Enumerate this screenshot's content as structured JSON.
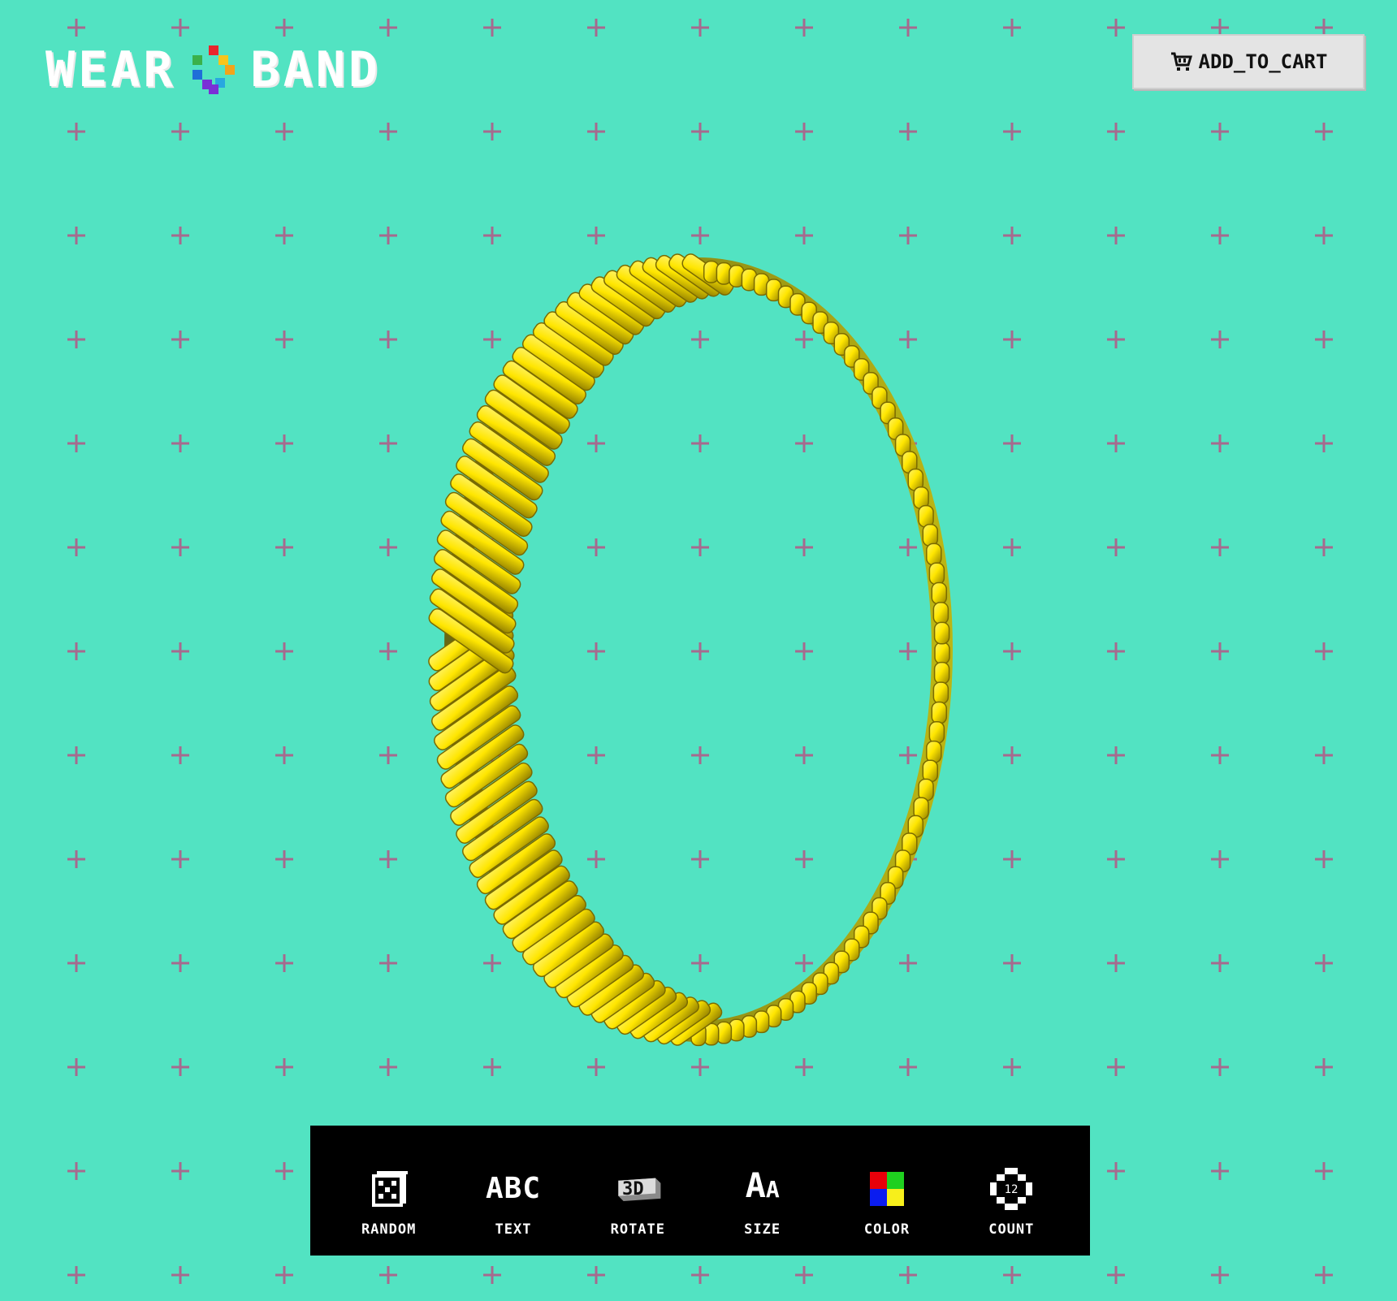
{
  "brand": {
    "word_left": "WEAR",
    "word_right": "BAND",
    "mark_colors": [
      "#e8262c",
      "#f7c51b",
      "#f2a41a",
      "#3ab14a",
      "#1f6fd8",
      "#7a2fd6",
      "#28a8e0"
    ]
  },
  "header": {
    "add_to_cart_label": "ADD_TO_CART",
    "cart_icon": "shopping-cart-icon"
  },
  "viewport": {
    "band_color": "#ffe600",
    "background_color": "#52e3c2",
    "grid_mark_color": "#a66a8e"
  },
  "toolbar": {
    "tools": [
      {
        "label": "RANDOM",
        "icon": "dice-icon"
      },
      {
        "label": "TEXT",
        "icon": "abc-text-icon",
        "glyph": "ABC"
      },
      {
        "label": "ROTATE",
        "icon": "3d-rotate-icon",
        "glyph": "3D"
      },
      {
        "label": "SIZE",
        "icon": "font-size-icon",
        "glyph_big": "A",
        "glyph_small": "A"
      },
      {
        "label": "COLOR",
        "icon": "color-palette-icon",
        "swatches": [
          "#e8000a",
          "#1fd01f",
          "#0a1cf0",
          "#f7ef1b"
        ]
      },
      {
        "label": "COUNT",
        "icon": "count-ring-icon",
        "glyph": "12"
      }
    ]
  }
}
